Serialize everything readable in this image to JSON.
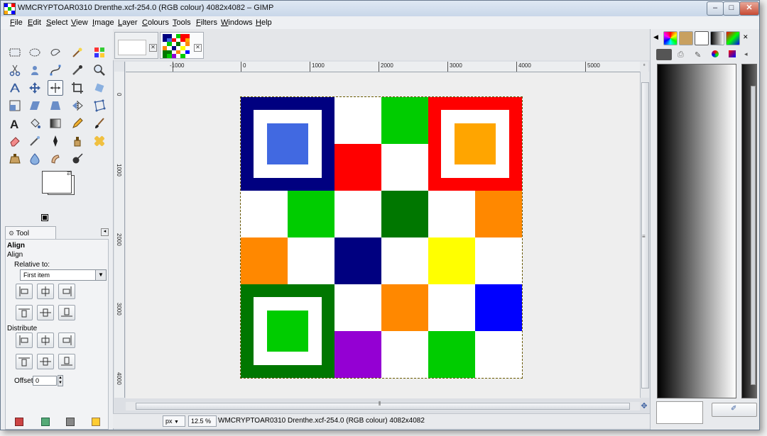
{
  "window": {
    "title": "WMCRYPTOAR0310 Drenthe.xcf-254.0 (RGB colour) 4082x4082 – GIMP",
    "minimize": "–",
    "maximize": "□",
    "close": "✕"
  },
  "menu": [
    "File",
    "Edit",
    "Select",
    "View",
    "Image",
    "Layer",
    "Colours",
    "Tools",
    "Filters",
    "Windows",
    "Help"
  ],
  "tool_options": {
    "tab_label": "Tool Options",
    "tool_name": "Align",
    "tool_name_sub": "Align",
    "relative_to_label": "Relative to:",
    "relative_to_value": "First item",
    "distribute_label": "Distribute",
    "offset_label": "Offset:",
    "offset_value": "0"
  },
  "ruler": {
    "h_labels": [
      "-1000",
      "0",
      "1000",
      "2000",
      "3000",
      "4000",
      "5000"
    ],
    "v_labels": [
      "0",
      "1000",
      "2000",
      "3000",
      "4000"
    ]
  },
  "statusbar": {
    "unit": "px",
    "zoom": "12.5 %",
    "text": "WMCRYPTOAR0310 Drenthe.xcf-254.0 (RGB colour) 4082x4082"
  },
  "colors": {
    "navy": "#000080",
    "royal_blue": "#4169e1",
    "green": "#00cc00",
    "dark_green": "#007700",
    "red": "#ff0000",
    "orange": "#ff8800",
    "gold": "#ffa500",
    "yellow": "#ffff00",
    "blue": "#0000ff",
    "purple": "#9400d3",
    "white": "#ffffff"
  },
  "board": {
    "cells": [
      {
        "r": 2,
        "c": 2,
        "color": "#ffffff"
      },
      {
        "r": 0,
        "c": 2,
        "color": "#ffffff"
      },
      {
        "r": 0,
        "c": 3,
        "color": "#00cc00"
      },
      {
        "r": 1,
        "c": 2,
        "color": "#ff0000"
      },
      {
        "r": 1,
        "c": 3,
        "color": "#ffffff"
      },
      {
        "r": 2,
        "c": 0,
        "color": "#ffffff"
      },
      {
        "r": 2,
        "c": 1,
        "color": "#00cc00"
      },
      {
        "r": 2,
        "c": 3,
        "color": "#007700"
      },
      {
        "r": 2,
        "c": 4,
        "color": "#ffffff"
      },
      {
        "r": 2,
        "c": 5,
        "color": "#ff8800"
      },
      {
        "r": 3,
        "c": 0,
        "color": "#ff8800"
      },
      {
        "r": 3,
        "c": 1,
        "color": "#ffffff"
      },
      {
        "r": 3,
        "c": 2,
        "color": "#000080"
      },
      {
        "r": 3,
        "c": 3,
        "color": "#ffffff"
      },
      {
        "r": 3,
        "c": 4,
        "color": "#ffff00"
      },
      {
        "r": 3,
        "c": 5,
        "color": "#ffffff"
      },
      {
        "r": 4,
        "c": 2,
        "color": "#ffffff"
      },
      {
        "r": 4,
        "c": 3,
        "color": "#ff8800"
      },
      {
        "r": 4,
        "c": 4,
        "color": "#ffffff"
      },
      {
        "r": 4,
        "c": 5,
        "color": "#0000ff"
      },
      {
        "r": 5,
        "c": 2,
        "color": "#9400d3"
      },
      {
        "r": 5,
        "c": 3,
        "color": "#ffffff"
      },
      {
        "r": 5,
        "c": 4,
        "color": "#00cc00"
      },
      {
        "r": 5,
        "c": 5,
        "color": "#ffffff"
      }
    ],
    "corner_squares": [
      {
        "name": "top-left",
        "r": 0,
        "c": 0,
        "outer": "#000080",
        "inner": "#4169e1"
      },
      {
        "name": "top-right",
        "r": 0,
        "c": 4,
        "outer": "#ff0000",
        "inner": "#ffa500"
      },
      {
        "name": "bottom-left",
        "r": 4,
        "c": 0,
        "outer": "#007700",
        "inner": "#00cc00"
      }
    ]
  }
}
